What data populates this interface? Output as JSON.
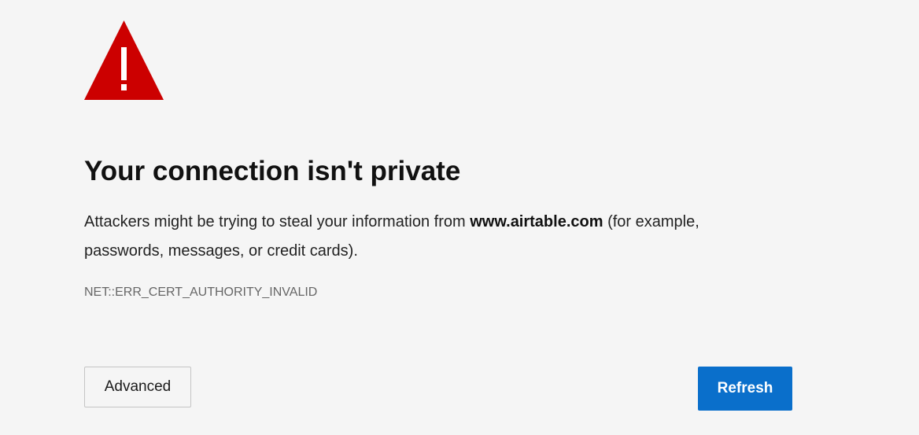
{
  "error_page": {
    "title": "Your connection isn't private",
    "description_prefix": "Attackers might be trying to steal your information from ",
    "domain": "www.airtable.com",
    "description_suffix": " (for example, passwords, messages, or credit cards).",
    "error_code": "NET::ERR_CERT_AUTHORITY_INVALID",
    "warning_icon": "warning-triangle-icon",
    "warning_color": "#cc0000"
  },
  "buttons": {
    "advanced_label": "Advanced",
    "refresh_label": "Refresh",
    "primary_color": "#0a6fcb"
  }
}
